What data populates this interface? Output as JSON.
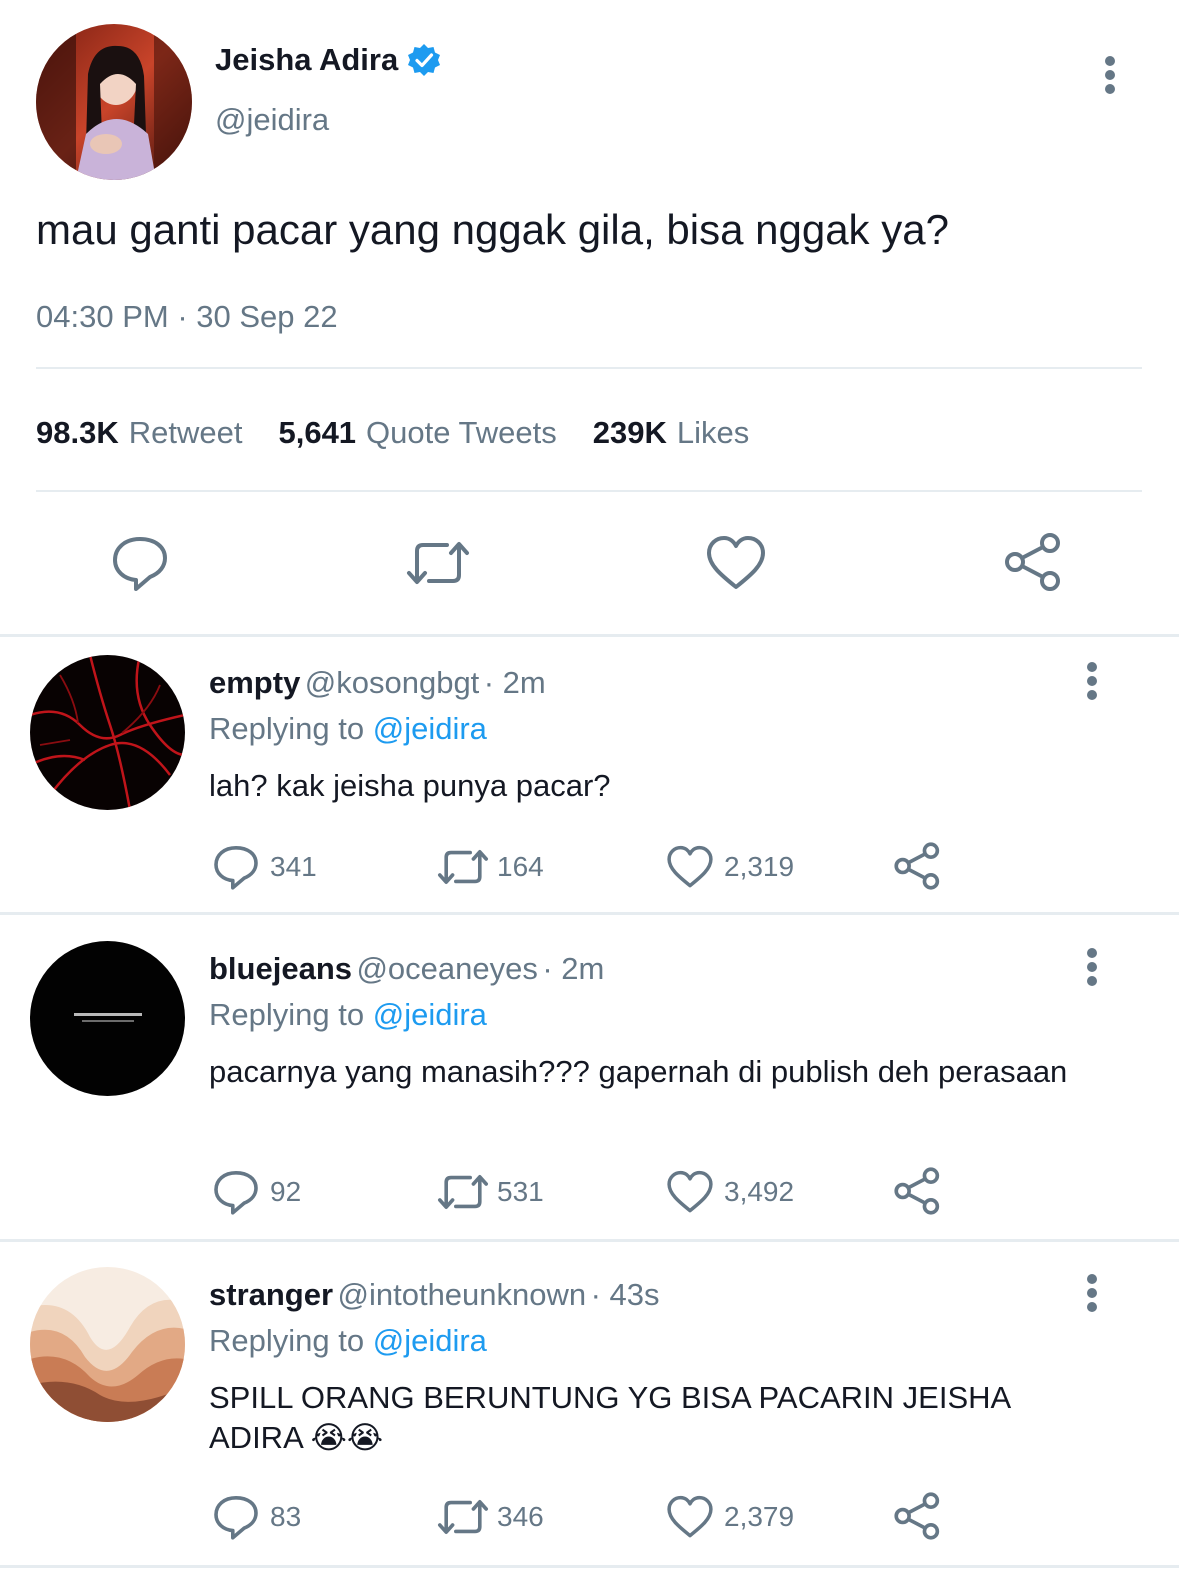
{
  "tweet": {
    "author_name": "Jeisha Adira",
    "author_handle": "@jeidira",
    "text": "mau ganti pacar yang nggak gila, bisa nggak ya?",
    "time": "04:30 PM",
    "separator": "·",
    "date": "30 Sep 22",
    "stats": {
      "retweets_count": "98.3K",
      "retweets_label": "Retweet",
      "quotes_count": "5,641",
      "quotes_label": "Quote Tweets",
      "likes_count": "239K",
      "likes_label": "Likes"
    },
    "icons": [
      "reply-icon",
      "retweet-icon",
      "like-icon",
      "share-icon"
    ]
  },
  "replies": [
    {
      "name": "empty",
      "handle": "@kosongbgt",
      "time": "· 2m",
      "replying_prefix": "Replying to",
      "replying_to": "@jeidira",
      "text": "lah? kak jeisha punya pacar?",
      "replies": "341",
      "retweets": "164",
      "likes": "2,319"
    },
    {
      "name": "bluejeans",
      "handle": "@oceaneyes",
      "time": "· 2m",
      "replying_prefix": "Replying to",
      "replying_to": "@jeidira",
      "text": "pacarnya yang manasih??? gapernah di publish deh perasaan",
      "replies": "92",
      "retweets": "531",
      "likes": "3,492"
    },
    {
      "name": "stranger",
      "handle": "@intotheunknown",
      "time": "· 43s",
      "replying_prefix": "Replying to",
      "replying_to": "@jeidira",
      "text": "SPILL ORANG BERUNTUNG YG BISA PACARIN JEISHA ADIRA 😭😭",
      "replies": "83",
      "retweets": "346",
      "likes": "2,379"
    }
  ],
  "colors": {
    "text": "#141823",
    "secondary": "#657786",
    "link": "#1d9bf0",
    "verified": "#1d9bf0",
    "divider": "#e6ecf0"
  }
}
